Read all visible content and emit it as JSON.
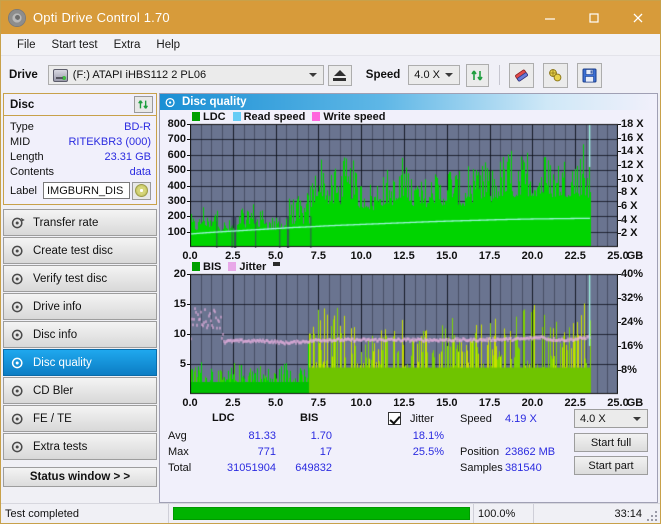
{
  "window": {
    "title": "Opti Drive Control 1.70",
    "icon": "disc-icon",
    "minimize": "minimize-icon",
    "maximize": "maximize-icon",
    "close": "close-icon"
  },
  "menu": {
    "items": [
      "File",
      "Start test",
      "Extra",
      "Help"
    ]
  },
  "toolbar": {
    "drive_label": "Drive",
    "drive_value": "(F:)  ATAPI iHBS112  2 PL06",
    "eject": "eject-icon",
    "speed_label": "Speed",
    "speed_value": "4.0 X",
    "refresh": "refresh-icon",
    "erase": "eraser-icon",
    "settings": "tools-icon",
    "save": "save-icon"
  },
  "disc": {
    "header": "Disc",
    "refresh": "refresh-icon",
    "rows": [
      {
        "key": "Type",
        "value": "BD-R"
      },
      {
        "key": "MID",
        "value": "RITEKBR3 (000)"
      },
      {
        "key": "Length",
        "value": "23.31 GB"
      },
      {
        "key": "Contents",
        "value": "data"
      }
    ],
    "label_key": "Label",
    "label_value": "IMGBURN_DIS",
    "label_icon": "disc-icon"
  },
  "nav": {
    "items": [
      {
        "label": "Transfer rate",
        "selected": false
      },
      {
        "label": "Create test disc",
        "selected": false
      },
      {
        "label": "Verify test disc",
        "selected": false
      },
      {
        "label": "Drive info",
        "selected": false
      },
      {
        "label": "Disc info",
        "selected": false
      },
      {
        "label": "Disc quality",
        "selected": true
      },
      {
        "label": "CD Bler",
        "selected": false
      },
      {
        "label": "FE / TE",
        "selected": false
      },
      {
        "label": "Extra tests",
        "selected": false
      }
    ],
    "status_button": "Status window > >"
  },
  "panel": {
    "title": "Disc quality",
    "icon": "disc-quality-icon"
  },
  "chart_data": [
    {
      "type": "area",
      "title": "LDC / Read speed",
      "xlabel": "GB",
      "ylabel": "LDC errors",
      "xlim": [
        0,
        25.0
      ],
      "ylim": [
        0,
        800
      ],
      "y2lim": [
        0,
        18
      ],
      "y2label": "X",
      "grid": true,
      "legend": [
        {
          "name": "LDC",
          "color": "#00a000"
        },
        {
          "name": "Read speed",
          "color": "#66ccf5"
        },
        {
          "name": "Write speed",
          "color": "#ff66dd"
        }
      ],
      "xticks": [
        "0.0",
        "2.5",
        "5.0",
        "7.5",
        "10.0",
        "12.5",
        "15.0",
        "17.5",
        "20.0",
        "22.5",
        "25.0"
      ],
      "yticks": [
        100,
        200,
        300,
        400,
        500,
        600,
        700,
        800
      ],
      "y2ticks": [
        "2 X",
        "4 X",
        "6 X",
        "8 X",
        "10 X",
        "12 X",
        "14 X",
        "16 X",
        "18 X"
      ],
      "data_end_gb": 23.4,
      "series": [
        {
          "name": "LDC",
          "color": "#00d400",
          "comment": "envelope max LDC per 0.25 GB bucket",
          "x": [
            0.0,
            0.25,
            0.5,
            0.75,
            1.0,
            1.25,
            1.5,
            1.75,
            2.0,
            2.25,
            2.5,
            2.75,
            3.0,
            3.25,
            3.5,
            3.75,
            4.0,
            4.25,
            4.5,
            4.75,
            5.0,
            5.25,
            5.5,
            5.75,
            6.0,
            6.25,
            6.5,
            6.75,
            7.0,
            7.25,
            7.5,
            7.75,
            8.0,
            8.25,
            8.5,
            8.75,
            9.0,
            9.25,
            9.5,
            9.75,
            10.0,
            10.25,
            10.5,
            10.75,
            11.0,
            11.25,
            11.5,
            11.75,
            12.0,
            12.25,
            12.5,
            12.75,
            13.0,
            13.25,
            13.5,
            13.75,
            14.0,
            14.25,
            14.5,
            14.75,
            15.0,
            15.25,
            15.5,
            15.75,
            16.0,
            16.25,
            16.5,
            16.75,
            17.0,
            17.25,
            17.5,
            17.75,
            18.0,
            18.25,
            18.5,
            18.75,
            19.0,
            19.25,
            19.5,
            19.75,
            20.0,
            20.25,
            20.5,
            20.75,
            21.0,
            21.25,
            21.5,
            21.75,
            22.0,
            22.25,
            22.5,
            22.75,
            23.0,
            23.25,
            23.4
          ],
          "y": [
            240,
            195,
            200,
            300,
            210,
            205,
            300,
            190,
            185,
            180,
            200,
            195,
            305,
            200,
            315,
            300,
            210,
            310,
            200,
            205,
            195,
            200,
            215,
            320,
            310,
            330,
            350,
            345,
            430,
            520,
            665,
            600,
            520,
            470,
            555,
            500,
            610,
            555,
            575,
            480,
            450,
            470,
            440,
            430,
            520,
            480,
            520,
            500,
            470,
            520,
            640,
            560,
            470,
            500,
            440,
            470,
            480,
            520,
            500,
            480,
            540,
            600,
            520,
            490,
            470,
            560,
            520,
            500,
            530,
            600,
            520,
            560,
            580,
            620,
            660,
            640,
            560,
            600,
            620,
            720,
            660,
            600,
            720,
            640,
            600,
            580,
            620,
            650,
            580,
            640,
            680,
            620,
            790,
            560,
            800
          ]
        },
        {
          "name": "Read speed",
          "color": "#9ff5df",
          "comment": "read speed in X, rising staircase from ~2X to ~4.2X",
          "x": [
            0.0,
            1.0,
            2.0,
            3.0,
            4.0,
            5.0,
            6.0,
            7.0,
            8.0,
            9.0,
            10.0,
            11.0,
            12.0,
            13.0,
            14.0,
            15.0,
            16.0,
            17.0,
            18.0,
            19.0,
            20.0,
            21.0,
            22.0,
            23.0,
            23.4
          ],
          "y": [
            1.9,
            2.1,
            2.25,
            2.4,
            2.55,
            2.7,
            2.85,
            2.95,
            3.1,
            3.2,
            3.3,
            3.4,
            3.5,
            3.6,
            3.7,
            3.78,
            3.85,
            3.92,
            4.0,
            4.05,
            4.1,
            4.13,
            4.16,
            4.19,
            4.19
          ]
        }
      ]
    },
    {
      "type": "area",
      "title": "BIS / Jitter",
      "xlabel": "GB",
      "ylabel": "BIS errors",
      "xlim": [
        0,
        25.0
      ],
      "ylim": [
        0,
        20
      ],
      "y2lim": [
        0,
        40
      ],
      "y2label": "%",
      "grid": true,
      "legend": [
        {
          "name": "BIS",
          "color": "#00a000"
        },
        {
          "name": "Jitter",
          "color": "#e8a8e8"
        }
      ],
      "xticks": [
        "0.0",
        "2.5",
        "5.0",
        "7.5",
        "10.0",
        "12.5",
        "15.0",
        "17.5",
        "20.0",
        "22.5",
        "25.0"
      ],
      "yticks": [
        5,
        10,
        15,
        20
      ],
      "y2ticks": [
        "8%",
        "16%",
        "24%",
        "32%",
        "40%"
      ],
      "data_end_gb": 23.4,
      "series": [
        {
          "name": "BIS",
          "color": "#b8e000",
          "comment": "envelope max BIS per 0.25 GB bucket",
          "x": [
            0.0,
            0.25,
            0.5,
            0.75,
            1.0,
            1.25,
            1.5,
            1.75,
            2.0,
            2.25,
            2.5,
            2.75,
            3.0,
            3.25,
            3.5,
            3.75,
            4.0,
            4.25,
            4.5,
            4.75,
            5.0,
            5.25,
            5.5,
            5.75,
            6.0,
            6.25,
            6.5,
            6.75,
            7.0,
            7.25,
            7.5,
            7.75,
            8.0,
            8.25,
            8.5,
            8.75,
            9.0,
            9.25,
            9.5,
            9.75,
            10.0,
            10.25,
            10.5,
            10.75,
            11.0,
            11.25,
            11.5,
            11.75,
            12.0,
            12.25,
            12.5,
            12.75,
            13.0,
            13.25,
            13.5,
            13.75,
            14.0,
            14.25,
            14.5,
            14.75,
            15.0,
            15.25,
            15.5,
            15.75,
            16.0,
            16.25,
            16.5,
            16.75,
            17.0,
            17.25,
            17.5,
            17.75,
            18.0,
            18.25,
            18.5,
            18.75,
            19.0,
            19.25,
            19.5,
            19.75,
            20.0,
            20.25,
            20.5,
            20.75,
            21.0,
            21.25,
            21.5,
            21.75,
            22.0,
            22.25,
            22.5,
            22.75,
            23.0,
            23.25,
            23.4
          ],
          "y": [
            4.2,
            5.0,
            7.5,
            4.5,
            4.2,
            6.0,
            4.8,
            4.0,
            3.5,
            4.2,
            5.5,
            5.0,
            5.2,
            5.6,
            6.2,
            5.5,
            5.2,
            5.0,
            4.6,
            4.4,
            4.2,
            4.8,
            5.6,
            6.0,
            6.2,
            6.0,
            6.2,
            6.4,
            11.5,
            14.0,
            17.0,
            15.5,
            14.0,
            12.5,
            16.2,
            13.0,
            14.0,
            12.0,
            12.5,
            11.0,
            11.5,
            11.0,
            10.5,
            11.0,
            14.2,
            12.0,
            12.5,
            12.5,
            12.0,
            13.0,
            14.0,
            12.5,
            11.0,
            12.0,
            10.5,
            11.0,
            11.0,
            12.0,
            12.5,
            11.5,
            12.0,
            13.0,
            11.5,
            11.0,
            11.0,
            12.5,
            12.0,
            11.5,
            12.5,
            13.0,
            12.0,
            12.5,
            13.0,
            14.0,
            16.5,
            15.5,
            13.0,
            14.0,
            15.0,
            17.0,
            16.0,
            14.0,
            17.0,
            15.0,
            13.0,
            12.5,
            13.5,
            14.0,
            12.5,
            14.0,
            17.0,
            13.5,
            16.0,
            13.0,
            17.0
          ]
        },
        {
          "name": "Jitter",
          "color": "#e8b0e0",
          "comment": "jitter % (plotted on left scale units), ~12.5 early then ~8.8 steady",
          "x": [
            0.0,
            0.25,
            0.5,
            0.75,
            1.0,
            1.25,
            1.5,
            1.75,
            2.0,
            2.25,
            2.5,
            3.0,
            3.5,
            4.0,
            4.5,
            5.0,
            5.5,
            6.0,
            6.5,
            7.0,
            7.5,
            8.0,
            9.0,
            10.0,
            11.0,
            12.0,
            13.0,
            14.0,
            15.0,
            16.0,
            17.0,
            18.0,
            19.0,
            20.0,
            20.5,
            21.0,
            22.0,
            23.0,
            23.4
          ],
          "y": [
            10.0,
            12.8,
            12.5,
            12.6,
            12.6,
            12.7,
            12.6,
            12.5,
            8.9,
            8.8,
            8.8,
            8.85,
            8.8,
            8.85,
            8.8,
            8.7,
            8.5,
            8.6,
            8.7,
            8.8,
            9.0,
            9.0,
            9.0,
            9.0,
            9.0,
            9.0,
            9.0,
            9.0,
            9.0,
            9.0,
            9.0,
            9.1,
            9.1,
            9.3,
            9.5,
            9.1,
            9.0,
            9.3,
            9.6
          ]
        }
      ]
    }
  ],
  "stats": {
    "col_headers": [
      "LDC",
      "BIS"
    ],
    "jitter_label": "Jitter",
    "jitter_checked": true,
    "rows": [
      {
        "label": "Avg",
        "ldc": "81.33",
        "bis": "1.70",
        "jitter": "18.1%"
      },
      {
        "label": "Max",
        "ldc": "771",
        "bis": "17",
        "jitter": "25.5%"
      },
      {
        "label": "Total",
        "ldc": "31051904",
        "bis": "649832",
        "jitter": ""
      }
    ],
    "speed_label": "Speed",
    "speed_value": "4.19 X",
    "position_label": "Position",
    "position_value": "23862 MB",
    "samples_label": "Samples",
    "samples_value": "381540",
    "speed_select": "4.0 X",
    "start_full": "Start full",
    "start_part": "Start part"
  },
  "statusbar": {
    "text": "Test completed",
    "progress_pct": 100.0,
    "progress_text": "100.0%",
    "time": "33:14"
  },
  "colors": {
    "titlebar": "#d79b3a",
    "accent": "#2b2be0",
    "plot_bg": "#6a7490",
    "ldc_green": "#00d400",
    "bis_yellow": "#b8e000",
    "jitter_pink": "#e8b0e0",
    "read_speed": "#9ff5df",
    "progress_green": "#00b300",
    "selected_nav": "#0c7dc4"
  }
}
